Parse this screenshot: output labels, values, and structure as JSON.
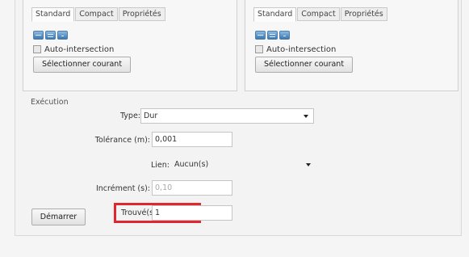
{
  "left_panel": {
    "tabs": [
      "Standard",
      "Compact",
      "Propriétés"
    ],
    "checkbox_label": "Auto-intersection",
    "select_button": "Sélectionner courant"
  },
  "right_panel": {
    "tabs": [
      "Standard",
      "Compact",
      "Propriétés"
    ],
    "checkbox_label": "Auto-intersection",
    "select_button": "Sélectionner courant"
  },
  "execution": {
    "legend": "Exécution",
    "type_label": "Type:",
    "type_value": "Dur",
    "tolerance_label": "Tolérance (m):",
    "tolerance_value": "0,001",
    "lien_label": "Lien:",
    "lien_value": "Aucun(s)",
    "increment_label": "Incrément (s):",
    "increment_value": "0,10",
    "start_button": "Démarrer",
    "found_label": "Trouvé(s):",
    "found_value": "1"
  },
  "colors": {
    "highlight": "#e2262f"
  },
  "icons": [
    "grid-view-icon",
    "list-view-icon",
    "details-view-icon"
  ]
}
